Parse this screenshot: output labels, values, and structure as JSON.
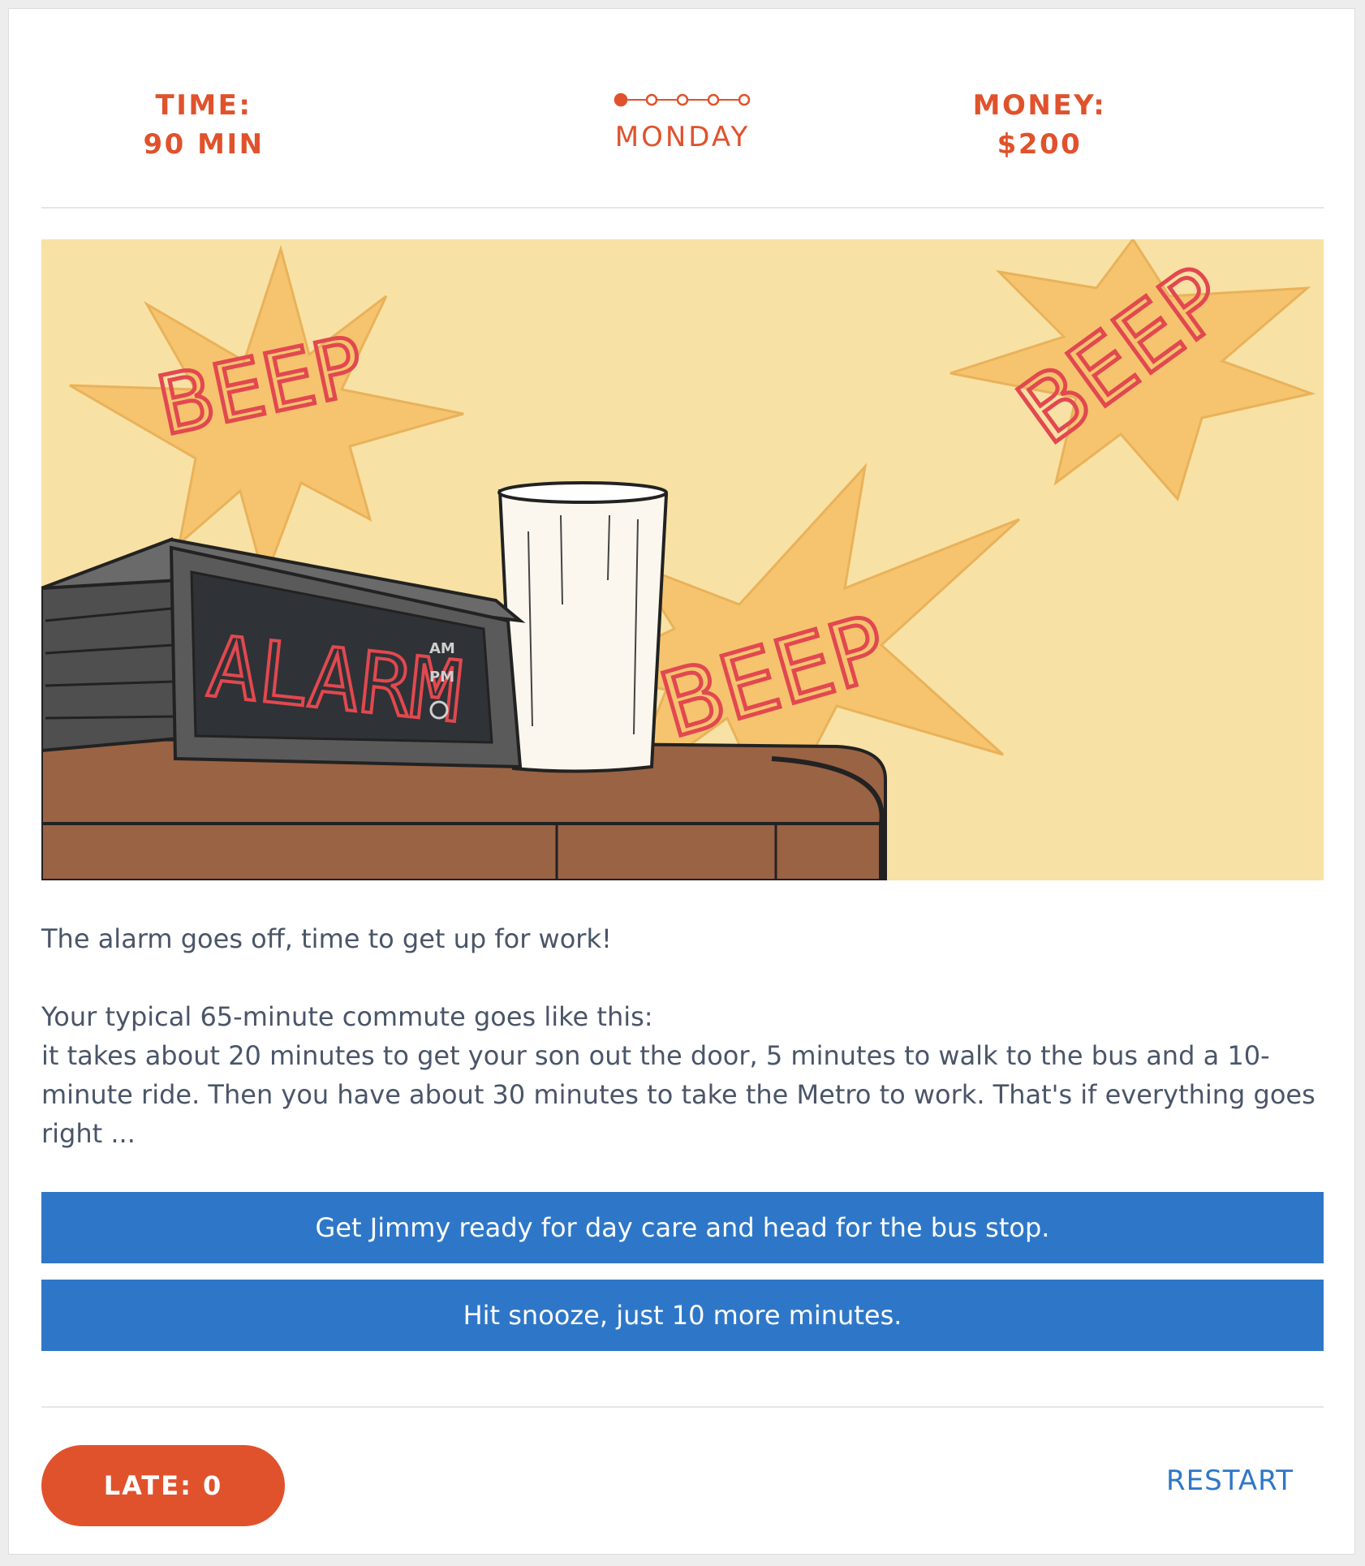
{
  "header": {
    "time_label": "TIME:",
    "time_value": "90 MIN",
    "day": "MONDAY",
    "money_label": "MONEY:",
    "money_value": "$200"
  },
  "progress": {
    "current_day": 1,
    "total_days": 5
  },
  "illustration": {
    "display_text": "ALARM",
    "am_label": "AM",
    "pm_label": "PM",
    "beep_text": "BEEP"
  },
  "story": {
    "line1": "The alarm goes off, time to get up for work!",
    "line2": "Your typical 65-minute commute goes like this:",
    "line3": "it takes about 20 minutes to get your son out the door, 5 minutes to walk to the bus and a 10-minute ride. Then you have about 30 minutes to take the Metro to work. That's if everything goes right ..."
  },
  "choices": [
    {
      "label": "Get Jimmy ready for day care and head for the bus stop."
    },
    {
      "label": "Hit snooze, just 10 more minutes."
    }
  ],
  "footer": {
    "late_label": "LATE: 0",
    "restart_label": "RESTART"
  },
  "colors": {
    "accent": "#e0522c",
    "button": "#2e77c8",
    "text": "#4a5568",
    "illustration_bg": "#f8e1a4",
    "burst": "#f6c46f",
    "beep_text": "#e2484f",
    "wood": "#9a6344"
  }
}
